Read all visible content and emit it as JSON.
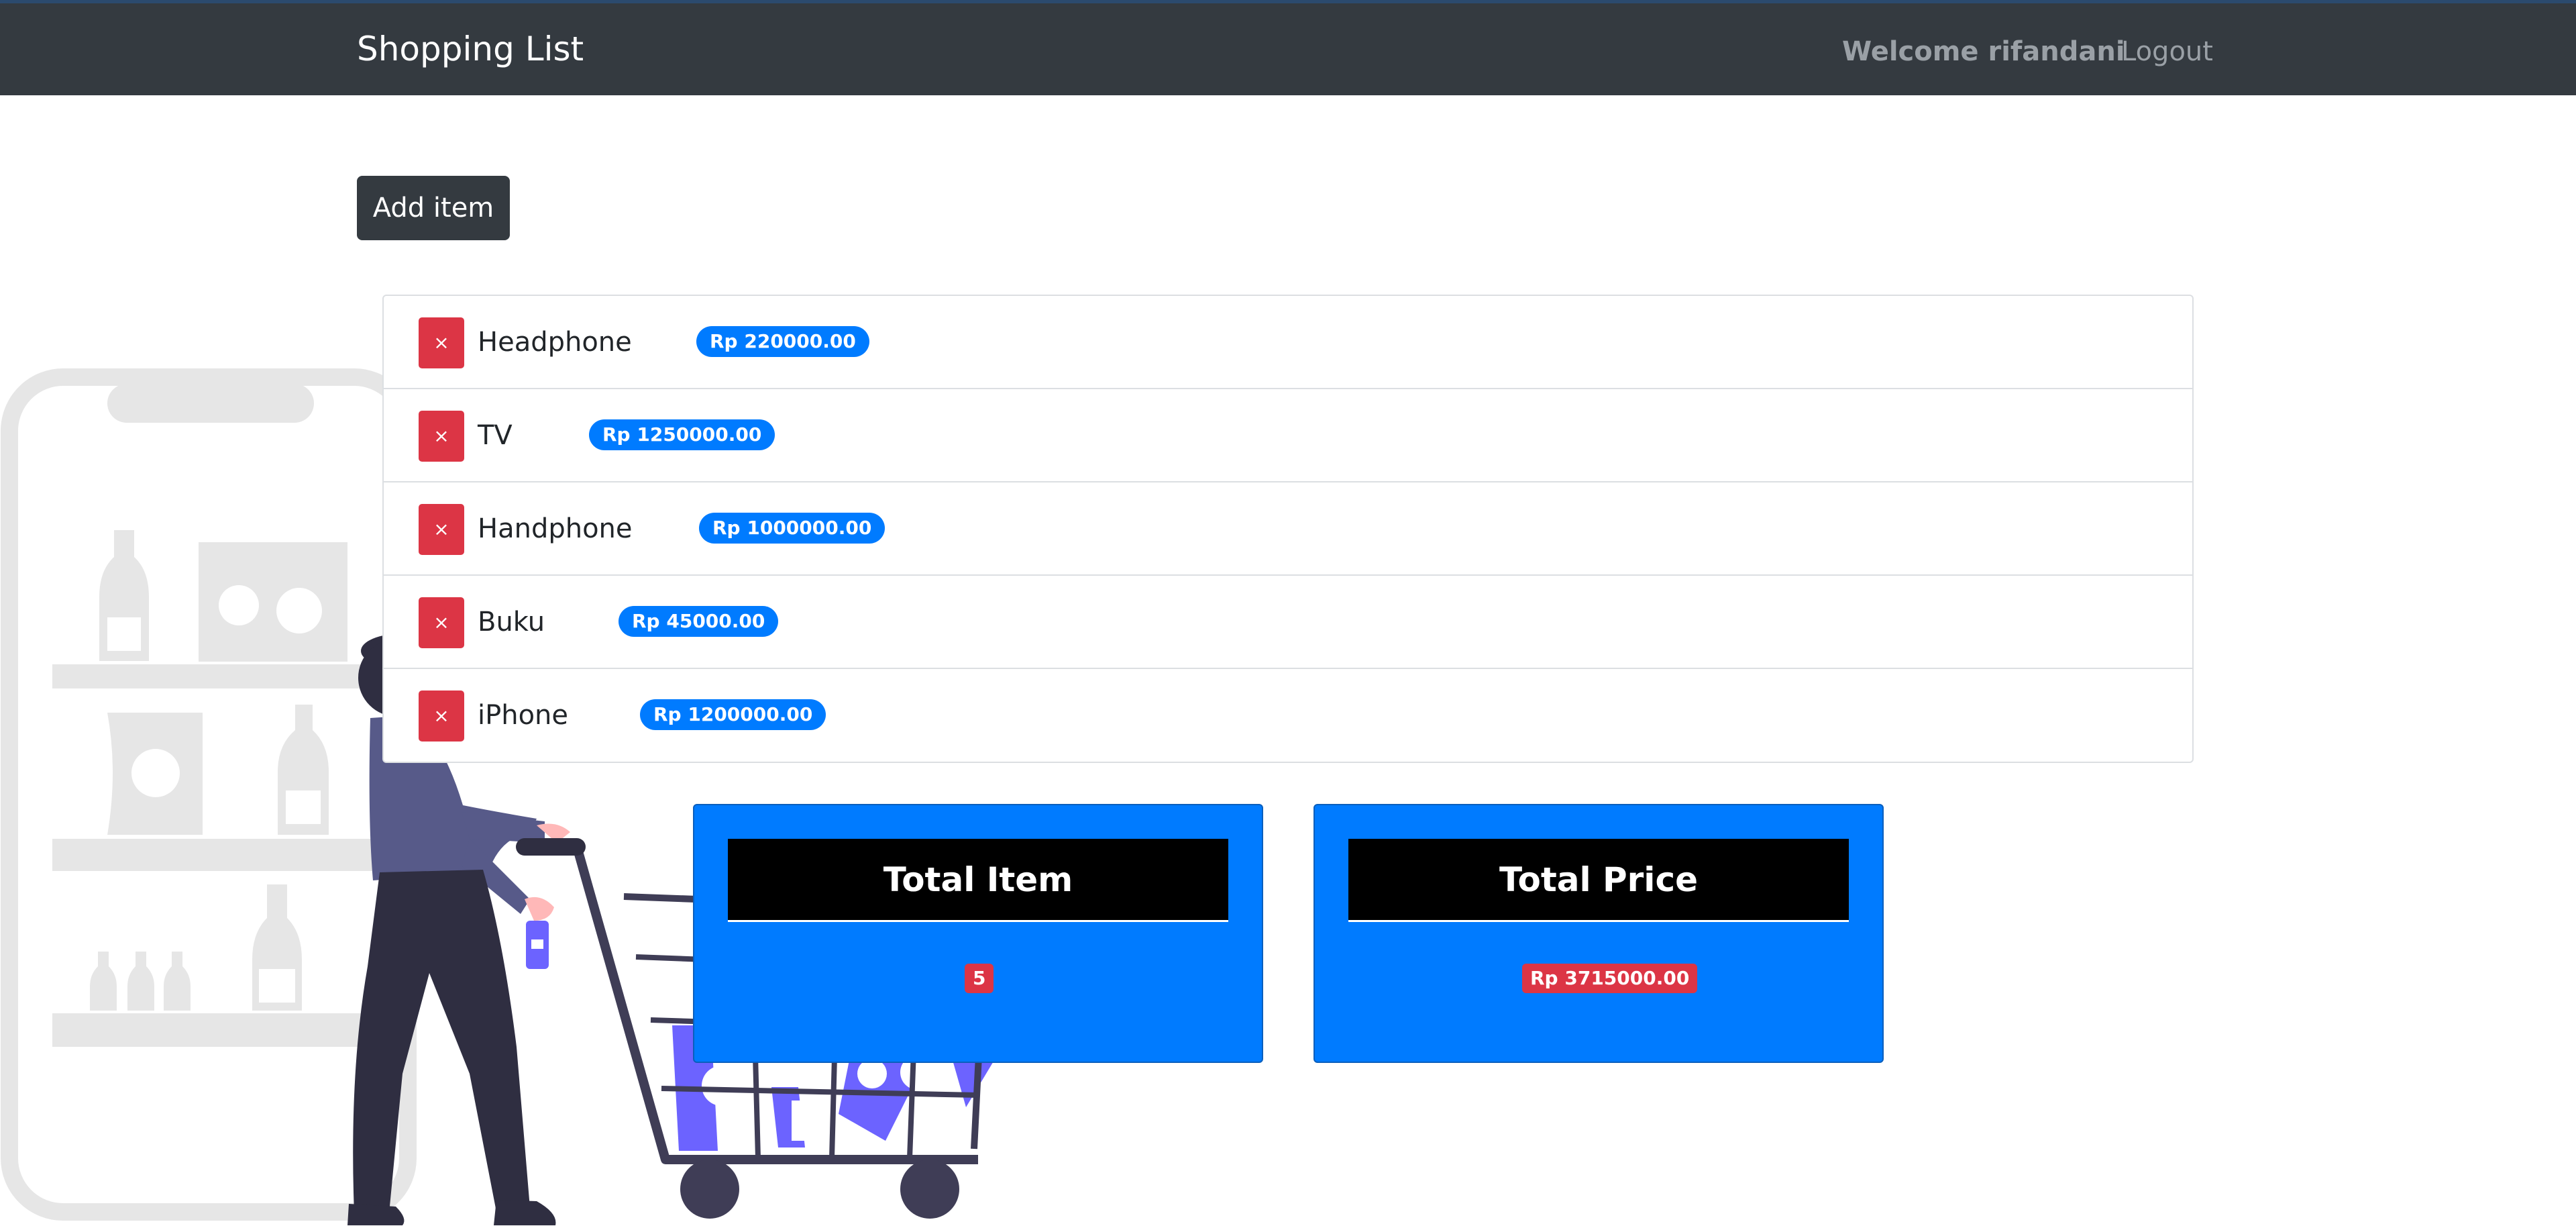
{
  "navbar": {
    "brand": "Shopping List",
    "welcome": "Welcome rifandani",
    "logout": "Logout"
  },
  "toolbar": {
    "add_label": "Add item"
  },
  "items": [
    {
      "name": "Headphone",
      "price": "Rp 220000.00",
      "delete_symbol": "×"
    },
    {
      "name": "TV",
      "price": "Rp 1250000.00",
      "delete_symbol": "×"
    },
    {
      "name": "Handphone",
      "price": "Rp 1000000.00",
      "delete_symbol": "×"
    },
    {
      "name": "Buku",
      "price": "Rp 45000.00",
      "delete_symbol": "×"
    },
    {
      "name": "iPhone",
      "price": "Rp 1200000.00",
      "delete_symbol": "×"
    }
  ],
  "summary": {
    "total_item_title": "Total Item",
    "total_item_value": "5",
    "total_price_title": "Total Price",
    "total_price_value": "Rp 3715000.00"
  },
  "colors": {
    "navbar": "#343a40",
    "primary": "#007bff",
    "danger": "#dc3545",
    "illustration_accent": "#6c63ff"
  }
}
